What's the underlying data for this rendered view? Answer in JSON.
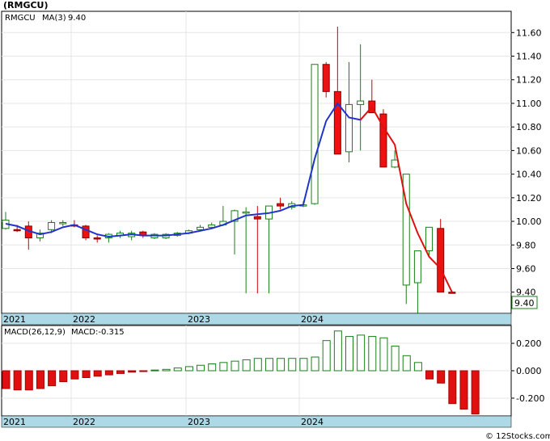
{
  "chart_data": [
    {
      "type": "candlestick",
      "title": "(RMGCU)",
      "legend": [
        {
          "label": "RMGCU",
          "color": "#1a7f1a"
        },
        {
          "label": "MA(3)",
          "color": "#2233cc"
        },
        {
          "label": "9.40",
          "color": "#2233cc"
        }
      ],
      "last_price_label": "9.40",
      "ylim": [
        9.22,
        11.78
      ],
      "y_ticks": [
        "11.60",
        "11.40",
        "11.20",
        "11.00",
        "10.80",
        "10.60",
        "10.40",
        "10.20",
        "10.00",
        "9.80",
        "9.60",
        "9.40"
      ],
      "year_labels": [
        "2021",
        "2022",
        "2023",
        "2024"
      ],
      "candles": [
        {
          "o": 9.94,
          "h": 10.08,
          "l": 9.93,
          "c": 10.01,
          "up": true
        },
        {
          "o": 9.93,
          "h": 9.97,
          "l": 9.91,
          "c": 9.93,
          "up": false
        },
        {
          "o": 9.96,
          "h": 10.0,
          "l": 9.76,
          "c": 9.86,
          "up": false
        },
        {
          "o": 9.86,
          "h": 9.93,
          "l": 9.83,
          "c": 9.9,
          "up": true
        },
        {
          "o": 9.93,
          "h": 10.01,
          "l": 9.9,
          "c": 9.99,
          "up": true
        },
        {
          "o": 9.99,
          "h": 10.01,
          "l": 9.96,
          "c": 9.98,
          "up": true
        },
        {
          "o": 9.97,
          "h": 10.01,
          "l": 9.95,
          "c": 9.96,
          "up": false
        },
        {
          "o": 9.96,
          "h": 9.97,
          "l": 9.84,
          "c": 9.86,
          "up": false
        },
        {
          "o": 9.86,
          "h": 9.88,
          "l": 9.82,
          "c": 9.85,
          "up": false
        },
        {
          "o": 9.86,
          "h": 9.9,
          "l": 9.82,
          "c": 9.89,
          "up": true
        },
        {
          "o": 9.88,
          "h": 9.92,
          "l": 9.86,
          "c": 9.9,
          "up": true
        },
        {
          "o": 9.9,
          "h": 9.92,
          "l": 9.84,
          "c": 9.87,
          "up": true
        },
        {
          "o": 9.91,
          "h": 9.92,
          "l": 9.86,
          "c": 9.88,
          "up": false
        },
        {
          "o": 9.86,
          "h": 9.9,
          "l": 9.85,
          "c": 9.89,
          "up": true
        },
        {
          "o": 9.86,
          "h": 9.9,
          "l": 9.85,
          "c": 9.89,
          "up": true
        },
        {
          "o": 9.88,
          "h": 9.91,
          "l": 9.87,
          "c": 9.9,
          "up": true
        },
        {
          "o": 9.9,
          "h": 9.93,
          "l": 9.89,
          "c": 9.92,
          "up": true
        },
        {
          "o": 9.93,
          "h": 9.97,
          "l": 9.92,
          "c": 9.95,
          "up": true
        },
        {
          "o": 9.95,
          "h": 9.99,
          "l": 9.94,
          "c": 9.97,
          "up": true
        },
        {
          "o": 9.97,
          "h": 10.13,
          "l": 9.96,
          "c": 10.0,
          "up": true
        },
        {
          "o": 10.0,
          "h": 10.1,
          "l": 9.72,
          "c": 10.09,
          "up": true
        },
        {
          "o": 10.08,
          "h": 10.12,
          "l": 9.39,
          "c": 10.07,
          "up": true
        },
        {
          "o": 10.04,
          "h": 10.13,
          "l": 9.39,
          "c": 10.02,
          "up": false
        },
        {
          "o": 10.02,
          "h": 10.13,
          "l": 9.39,
          "c": 10.13,
          "up": true
        },
        {
          "o": 10.15,
          "h": 10.2,
          "l": 10.1,
          "c": 10.13,
          "up": false
        },
        {
          "o": 10.12,
          "h": 10.17,
          "l": 10.1,
          "c": 10.15,
          "up": true
        },
        {
          "o": 10.14,
          "h": 10.17,
          "l": 10.12,
          "c": 10.13,
          "up": true
        },
        {
          "o": 10.15,
          "h": 11.33,
          "l": 10.14,
          "c": 11.33,
          "up": true
        },
        {
          "o": 11.33,
          "h": 11.35,
          "l": 11.05,
          "c": 11.1,
          "up": false
        },
        {
          "o": 11.1,
          "h": 11.65,
          "l": 10.57,
          "c": 10.57,
          "up": false
        },
        {
          "o": 10.59,
          "h": 11.35,
          "l": 10.5,
          "c": 10.99,
          "up": true
        },
        {
          "o": 10.99,
          "h": 11.5,
          "l": 10.6,
          "c": 11.02,
          "up": true
        },
        {
          "o": 11.02,
          "h": 11.2,
          "l": 10.93,
          "c": 10.92,
          "up": false
        },
        {
          "o": 10.91,
          "h": 10.95,
          "l": 10.46,
          "c": 10.46,
          "up": false
        },
        {
          "o": 10.46,
          "h": 10.6,
          "l": 10.45,
          "c": 10.52,
          "up": true
        },
        {
          "o": 10.4,
          "h": 10.37,
          "l": 9.3,
          "c": 9.46,
          "up": true
        },
        {
          "o": 9.48,
          "h": 9.75,
          "l": 9.22,
          "c": 9.75,
          "up": true
        },
        {
          "o": 9.75,
          "h": 9.95,
          "l": 9.7,
          "c": 9.95,
          "up": true
        },
        {
          "o": 9.94,
          "h": 10.02,
          "l": 9.4,
          "c": 9.4,
          "up": false
        },
        {
          "o": 9.4,
          "h": 9.4,
          "l": 9.4,
          "c": 9.4,
          "up": false
        }
      ],
      "ma": [
        9.98,
        9.96,
        9.92,
        9.89,
        9.91,
        9.95,
        9.97,
        9.93,
        9.89,
        9.87,
        9.88,
        9.89,
        9.88,
        9.88,
        9.88,
        9.89,
        9.9,
        9.92,
        9.94,
        9.97,
        10.01,
        10.05,
        10.06,
        10.07,
        10.09,
        10.13,
        10.14,
        10.53,
        10.85,
        11.0,
        10.88,
        10.86,
        10.97,
        10.8,
        10.65,
        10.15,
        9.9,
        9.7,
        9.6,
        9.4
      ],
      "ma_color_change_index": 31,
      "ma_colors": {
        "rising": "#2233cc",
        "falling": "#e01010"
      }
    },
    {
      "type": "bar",
      "title": "",
      "legend": [
        {
          "label": "MACD(26,12,9)"
        },
        {
          "label": "MACD:-0.315",
          "color": "#2233cc"
        }
      ],
      "ylim": [
        -0.33,
        0.33
      ],
      "y_ticks": [
        "0.200",
        "0.000",
        "-0.200"
      ],
      "year_labels": [
        "2021",
        "2022",
        "2023",
        "2024"
      ],
      "values": [
        -0.13,
        -0.14,
        -0.14,
        -0.13,
        -0.11,
        -0.08,
        -0.06,
        -0.05,
        -0.04,
        -0.03,
        -0.02,
        -0.01,
        -0.005,
        0.005,
        0.01,
        0.02,
        0.03,
        0.04,
        0.05,
        0.06,
        0.07,
        0.08,
        0.09,
        0.09,
        0.09,
        0.09,
        0.09,
        0.1,
        0.22,
        0.29,
        0.25,
        0.26,
        0.25,
        0.24,
        0.18,
        0.11,
        0.06,
        -0.06,
        -0.09,
        -0.24,
        -0.28,
        -0.315
      ],
      "colors": {
        "positive": "#1a7f1a",
        "negative": "#e01010"
      }
    }
  ],
  "footer": {
    "credit": "© 12Stocks.com"
  }
}
